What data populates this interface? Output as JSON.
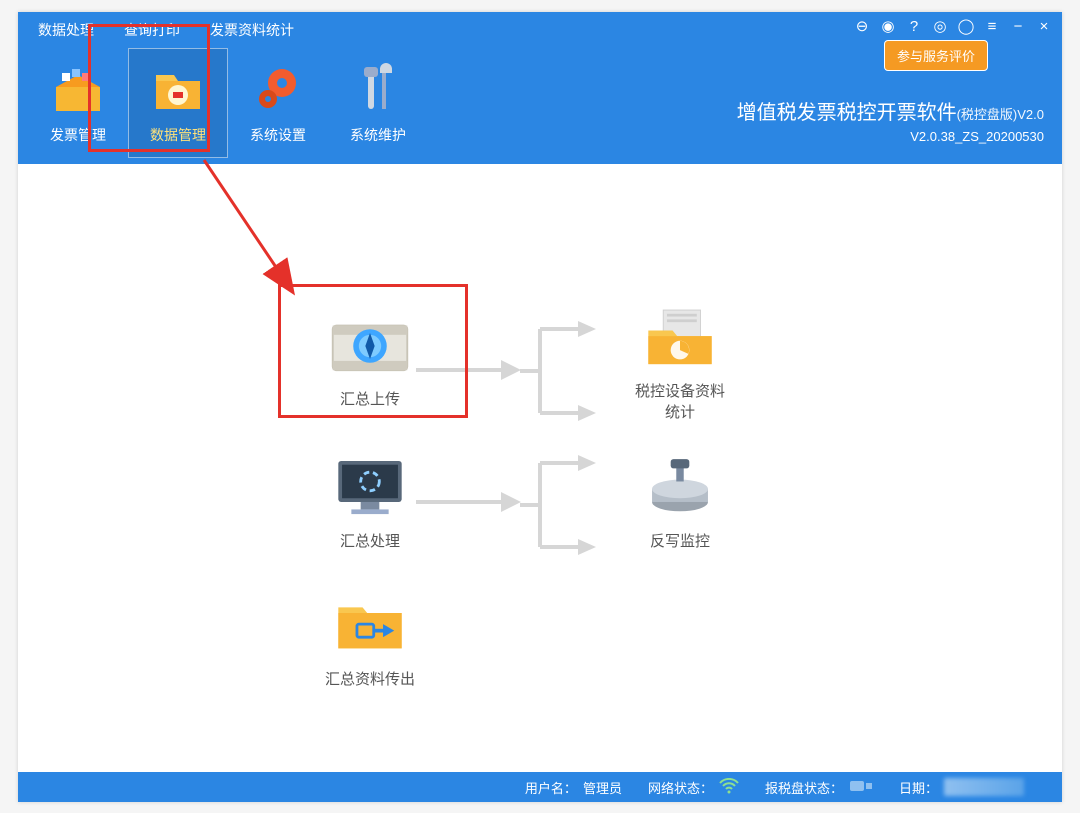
{
  "menu": {
    "items": [
      "数据处理",
      "查询打印",
      "发票资料统计"
    ]
  },
  "eval_tag": "参与服务评价",
  "titlebar": {
    "icons": [
      "sync-icon",
      "help-circle-icon",
      "question-icon",
      "lock-icon",
      "user-icon",
      "menu-icon",
      "minimize-icon",
      "close-icon"
    ]
  },
  "app_title": {
    "main": "增值税发票税控开票软件",
    "edition": "(税控盘版)V2.0"
  },
  "app_version": "V2.0.38_ZS_20200530",
  "toolbar": [
    {
      "label": "发票管理",
      "name": "invoice-management",
      "active": false
    },
    {
      "label": "数据管理",
      "name": "data-management",
      "active": true
    },
    {
      "label": "系统设置",
      "name": "system-settings",
      "active": false
    },
    {
      "label": "系统维护",
      "name": "system-maintenance",
      "active": false
    }
  ],
  "modules": {
    "summary_upload": "汇总上传",
    "tax_device_stats_line1": "税控设备资料",
    "tax_device_stats_line2": "统计",
    "summary_process": "汇总处理",
    "rewrite_monitor": "反写监控",
    "summary_export": "汇总资料传出"
  },
  "footer": {
    "user_label": "用户名：",
    "user_value": "管理员",
    "net_label": "网络状态：",
    "report_label": "报税盘状态：",
    "date_label": "日期："
  }
}
